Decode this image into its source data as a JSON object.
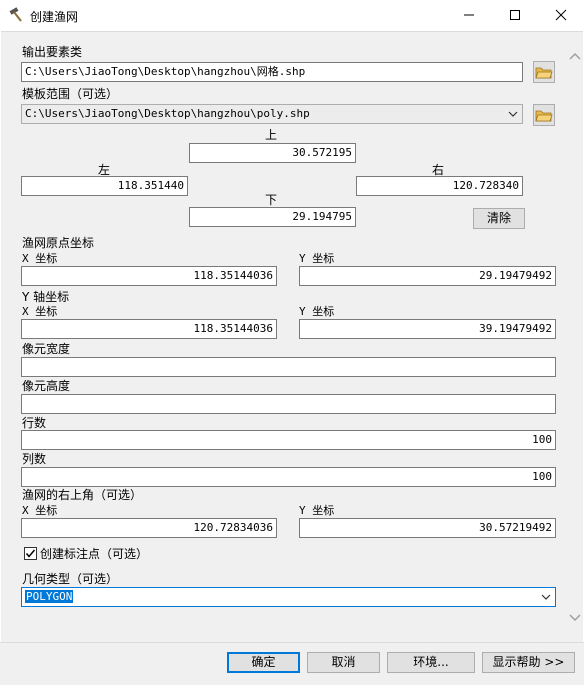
{
  "window": {
    "title": "创建渔网"
  },
  "output": {
    "label": "输出要素类",
    "value": "C:\\Users\\JiaoTong\\Desktop\\hangzhou\\网格.shp"
  },
  "template": {
    "label": "模板范围（可选）",
    "value": "C:\\Users\\JiaoTong\\Desktop\\hangzhou\\poly.shp"
  },
  "extent": {
    "top_label": "上",
    "top": "30.572195",
    "left_label": "左",
    "left": "118.351440",
    "right_label": "右",
    "right": "120.728340",
    "bottom_label": "下",
    "bottom": "29.194795",
    "clear_label": "清除"
  },
  "origin": {
    "label": "渔网原点坐标",
    "x_label": "X 坐标",
    "x": "118.35144036",
    "y_label": "Y 坐标",
    "y": "29.19479492"
  },
  "yaxis": {
    "label": "Y 轴坐标",
    "x_label": "X 坐标",
    "x": "118.35144036",
    "y_label": "Y 坐标",
    "y": "39.19479492"
  },
  "cell_width": {
    "label": "像元宽度",
    "value": ""
  },
  "cell_height": {
    "label": "像元高度",
    "value": ""
  },
  "rows": {
    "label": "行数",
    "value": "100"
  },
  "cols": {
    "label": "列数",
    "value": "100"
  },
  "corner": {
    "label": "渔网的右上角（可选）",
    "x_label": "X 坐标",
    "x": "120.72834036",
    "y_label": "Y 坐标",
    "y": "30.57219492"
  },
  "label_points": {
    "label": "创建标注点（可选）",
    "checked": true
  },
  "geometry": {
    "label": "几何类型（可选）",
    "value": "POLYGON"
  },
  "buttons": {
    "ok": "确定",
    "cancel": "取消",
    "env": "环境...",
    "help": "显示帮助 >>"
  }
}
